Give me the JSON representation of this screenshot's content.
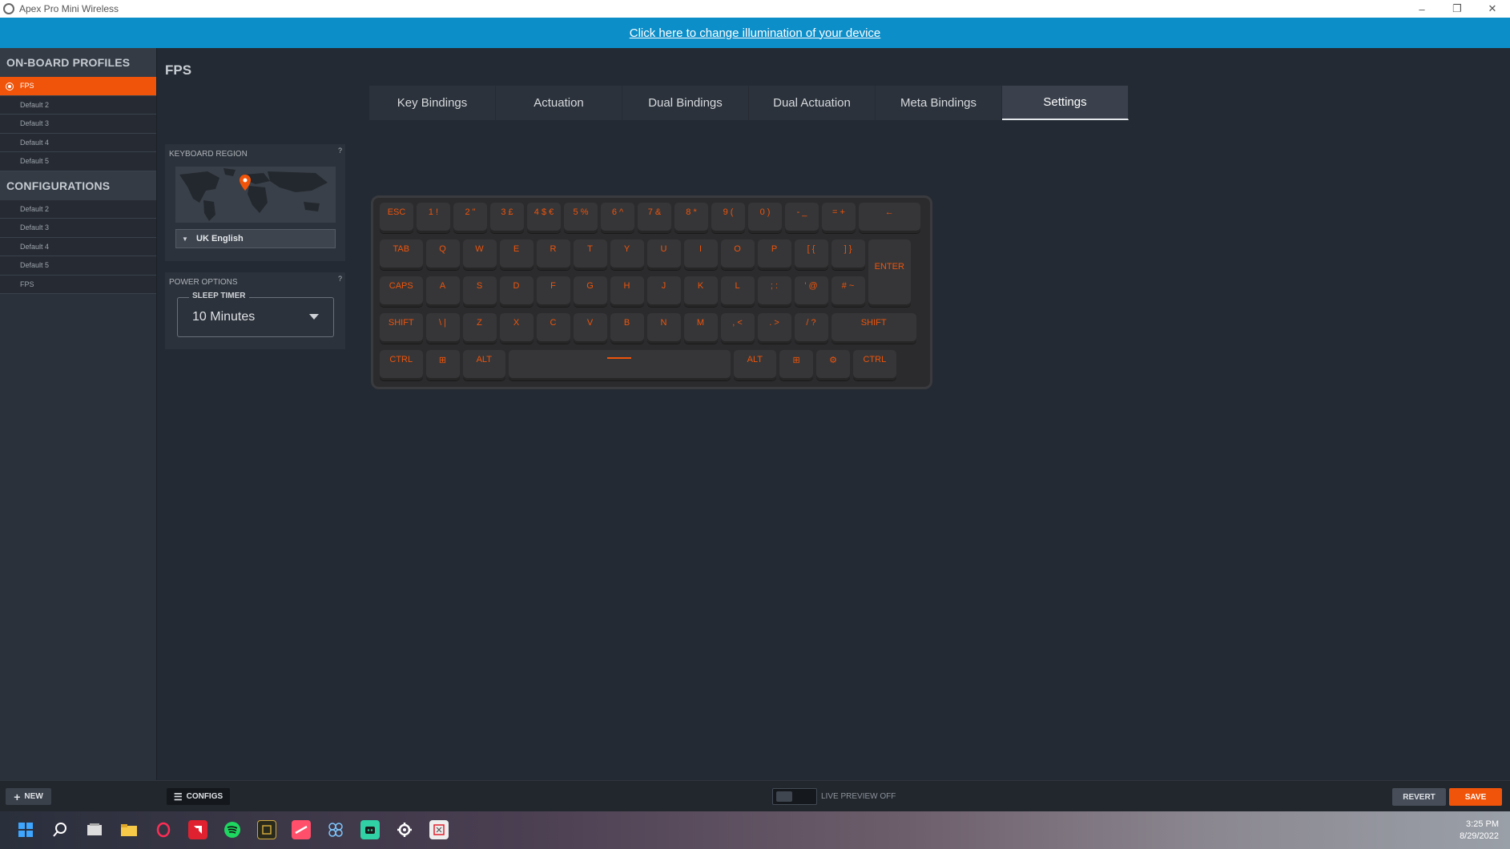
{
  "window": {
    "title": "Apex Pro Mini Wireless",
    "controls": [
      "–",
      "❐",
      "✕"
    ]
  },
  "banner": {
    "link_text": "Click here to change illumination of your device"
  },
  "sidebar": {
    "profiles_heading": "ON-BOARD PROFILES",
    "profiles": [
      {
        "label": "FPS",
        "active": true
      },
      {
        "label": "Default 2"
      },
      {
        "label": "Default 3"
      },
      {
        "label": "Default 4"
      },
      {
        "label": "Default 5"
      }
    ],
    "configs_heading": "CONFIGURATIONS",
    "configurations": [
      {
        "label": "Default 2"
      },
      {
        "label": "Default 3"
      },
      {
        "label": "Default 4"
      },
      {
        "label": "Default 5"
      },
      {
        "label": "FPS"
      }
    ]
  },
  "main": {
    "title": "FPS",
    "tabs": [
      "Key Bindings",
      "Actuation",
      "Dual Bindings",
      "Dual Actuation",
      "Meta Bindings",
      "Settings"
    ],
    "active_tab": "Settings"
  },
  "keyboard_region": {
    "label": "KEYBOARD REGION",
    "help": "?",
    "selected": "UK English"
  },
  "power_options": {
    "label": "POWER OPTIONS",
    "help": "?",
    "sleep_timer_label": "SLEEP TIMER",
    "sleep_timer_value": "10 Minutes"
  },
  "keyboard": {
    "accent_color": "#f0540a",
    "rows": [
      [
        "ESC",
        "1 !",
        "2 \"",
        "3 £",
        "4 $ €",
        "5 %",
        "6 ^",
        "7 &",
        "8 *",
        "9 (",
        "0 )",
        "- _",
        "= +",
        "←"
      ],
      [
        "TAB",
        "Q",
        "W",
        "E",
        "R",
        "T",
        "Y",
        "U",
        "I",
        "O",
        "P",
        "[ {",
        "] }",
        "ENTER"
      ],
      [
        "CAPS",
        "A",
        "S",
        "D",
        "F",
        "G",
        "H",
        "J",
        "K",
        "L",
        "; :",
        "' @",
        "# ~"
      ],
      [
        "SHIFT",
        "\\ |",
        "Z",
        "X",
        "C",
        "V",
        "B",
        "N",
        "M",
        ", <",
        ". >",
        "/ ?",
        "SHIFT"
      ],
      [
        "CTRL",
        "⊞",
        "ALT",
        "",
        "ALT",
        "⊞",
        "⚙",
        "CTRL"
      ]
    ]
  },
  "bottom": {
    "new_label": "NEW",
    "configs_label": "CONFIGS",
    "live_preview_label": "LIVE PREVIEW OFF",
    "revert_label": "REVERT",
    "save_label": "SAVE"
  },
  "taskbar": {
    "time": "3:25 PM",
    "date": "8/29/2022"
  }
}
